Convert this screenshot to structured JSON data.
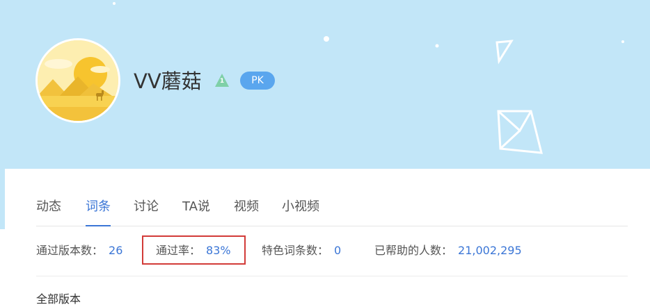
{
  "profile": {
    "username": "VV蘑菇",
    "level": "1",
    "pk_label": "PK"
  },
  "tabs": [
    {
      "label": "动态",
      "active": false
    },
    {
      "label": "词条",
      "active": true
    },
    {
      "label": "讨论",
      "active": false
    },
    {
      "label": "TA说",
      "active": false
    },
    {
      "label": "视频",
      "active": false
    },
    {
      "label": "小视频",
      "active": false
    }
  ],
  "stats": [
    {
      "label": "通过版本数：",
      "value": "26"
    },
    {
      "label": "通过率：",
      "value": "83%"
    },
    {
      "label": "特色词条数：",
      "value": "0"
    },
    {
      "label": "已帮助的人数：",
      "value": "21,002,295"
    }
  ],
  "section_label": "全部版本",
  "colors": {
    "banner_bg": "#c2e6f8",
    "accent_blue": "#3b76d6",
    "pk_badge": "#5aa6ee",
    "highlight_border": "#d23b38",
    "level_badge": "#7fd0a8"
  },
  "icons": {
    "level_badge": "triangle-level-icon",
    "avatar": "desert-sun-avatar"
  }
}
